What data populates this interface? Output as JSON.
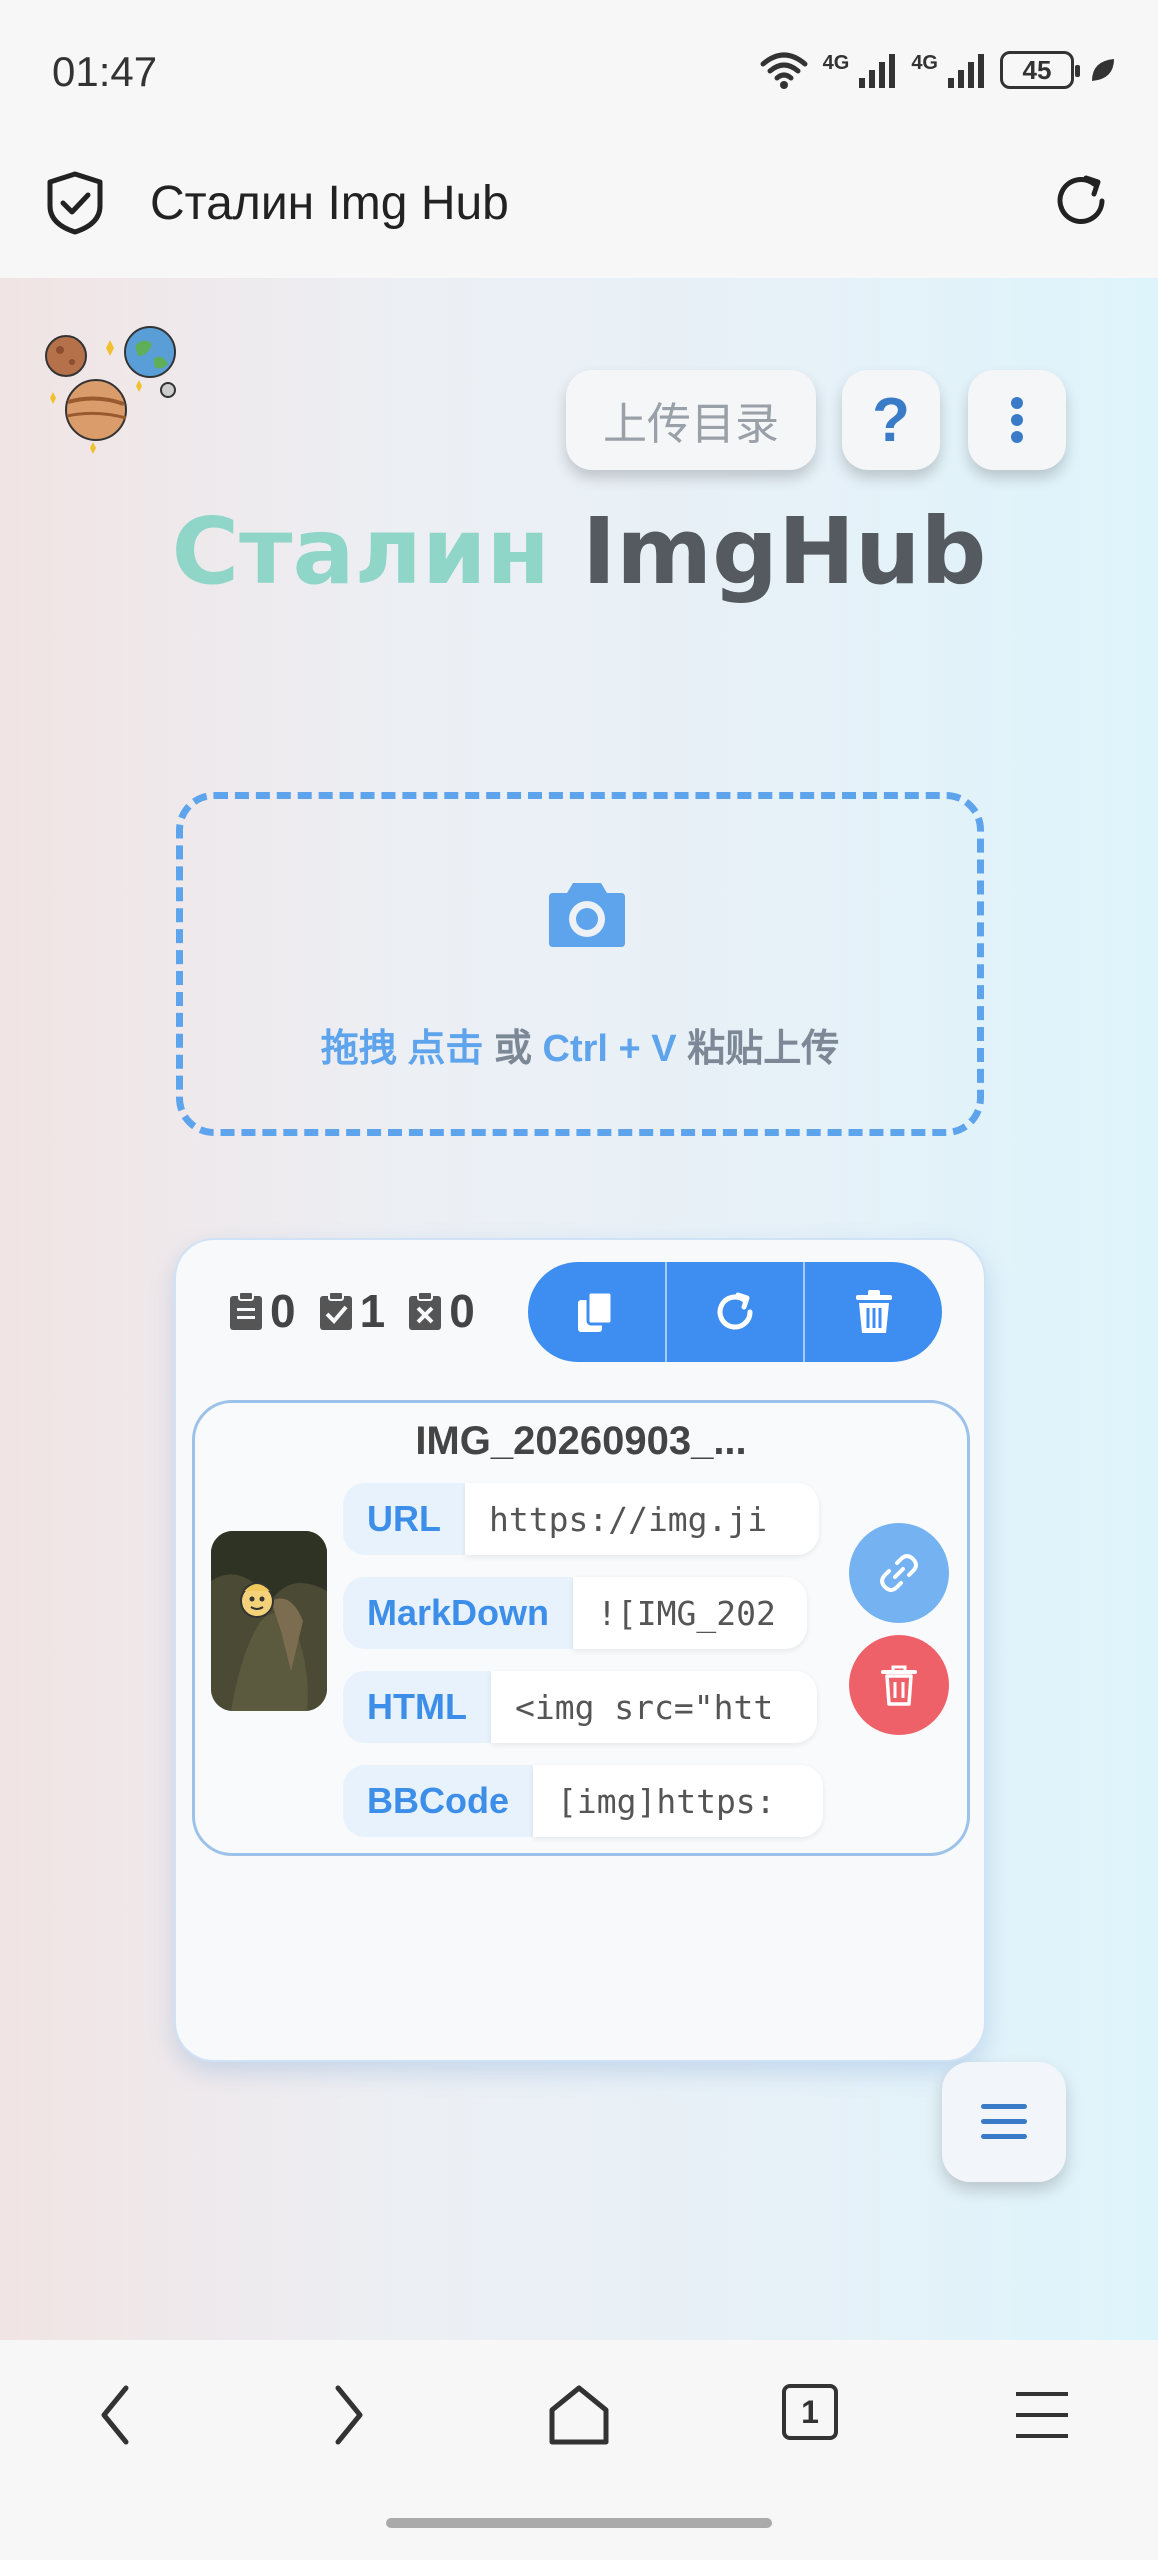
{
  "status_bar": {
    "time": "01:47",
    "network_1": "4G",
    "network_2": "4G",
    "battery": "45"
  },
  "browser": {
    "title": "Сталин Img Hub"
  },
  "header": {
    "upload_dir_label": "上传目录",
    "help_label": "?",
    "brand_part1": "Сталин",
    "brand_part2": "ImgHub"
  },
  "dropzone": {
    "drag": "拖拽",
    "click": "点击",
    "or": "或",
    "shortcut": "Ctrl + V",
    "paste_upload": "粘贴上传"
  },
  "panel": {
    "counts": {
      "pending": "0",
      "done": "1",
      "failed": "0"
    },
    "item": {
      "title": "IMG_20260903_...",
      "rows": [
        {
          "label": "URL",
          "value": "https://img.ji"
        },
        {
          "label": "MarkDown",
          "value": "![IMG_202"
        },
        {
          "label": "HTML",
          "value": "<img src=\"htt"
        },
        {
          "label": "BBCode",
          "value": "[img]https:"
        }
      ]
    }
  },
  "bottom_nav": {
    "tab_count": "1"
  },
  "colors": {
    "accent": "#3d8ef0",
    "danger": "#ef6168",
    "brand_teal": "#8fd5c8"
  }
}
